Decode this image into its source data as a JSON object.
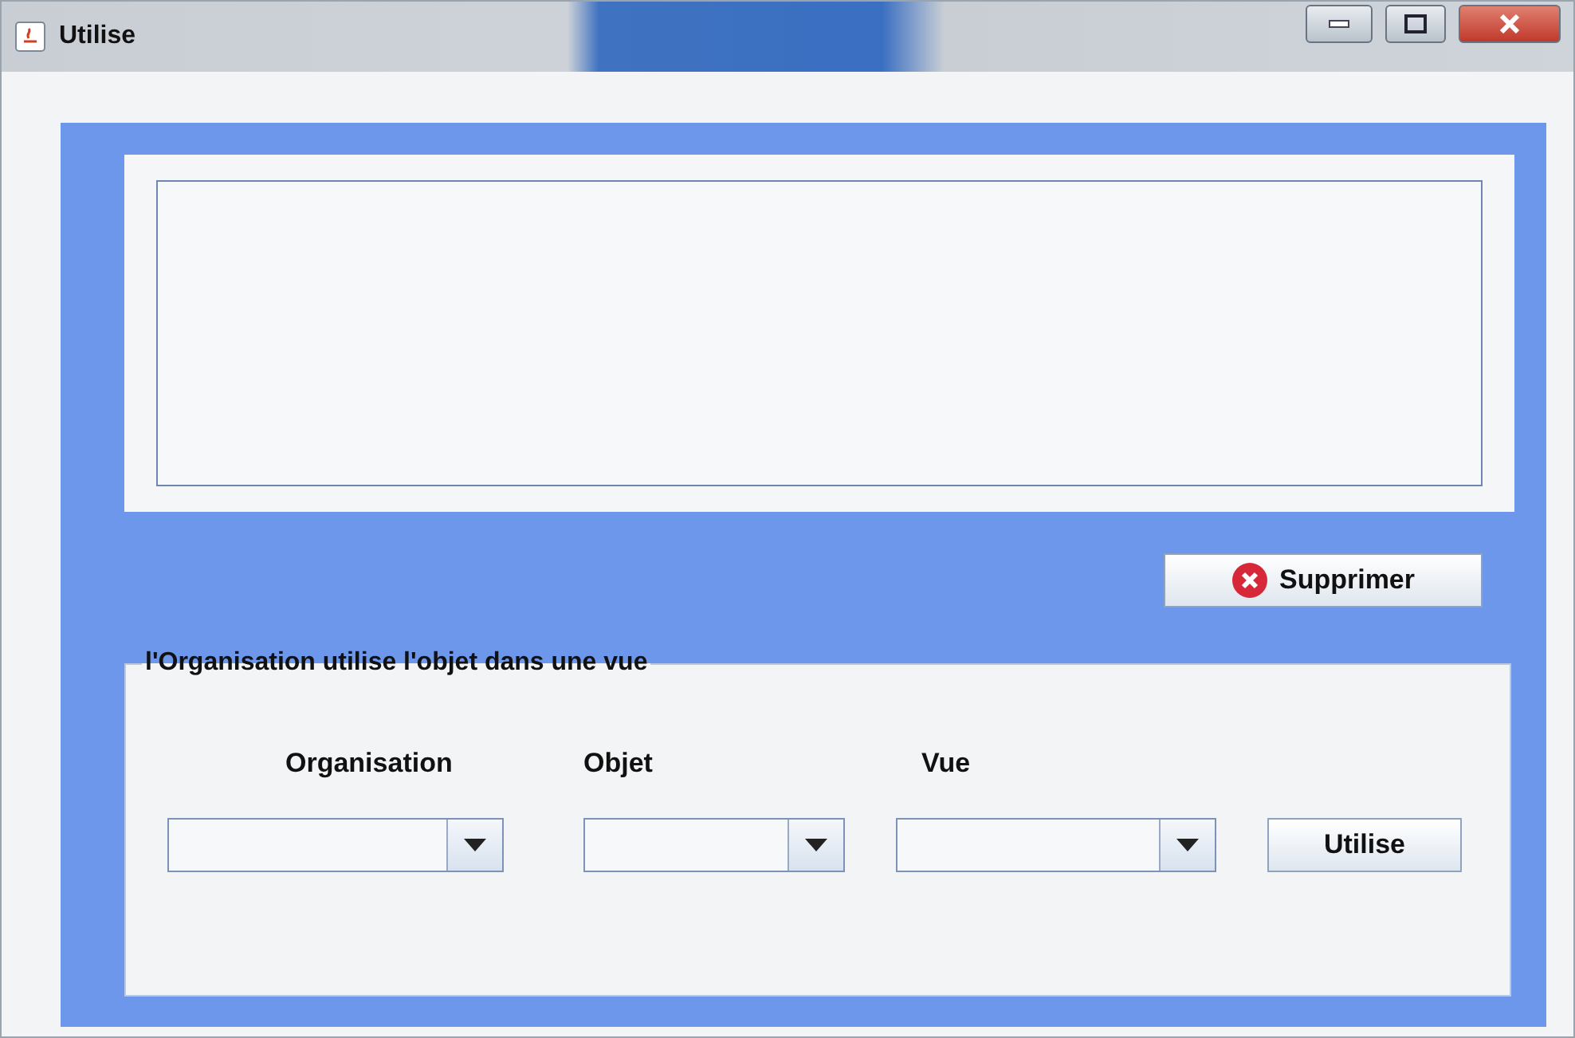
{
  "window": {
    "title": "Utilise"
  },
  "delete_button": {
    "label": "Supprimer"
  },
  "group": {
    "title": "l'Organisation utilise l'objet dans une vue",
    "fields": [
      {
        "label": "Organisation"
      },
      {
        "label": "Objet"
      },
      {
        "label": "Vue"
      }
    ],
    "button": {
      "label": "Utilise"
    }
  }
}
